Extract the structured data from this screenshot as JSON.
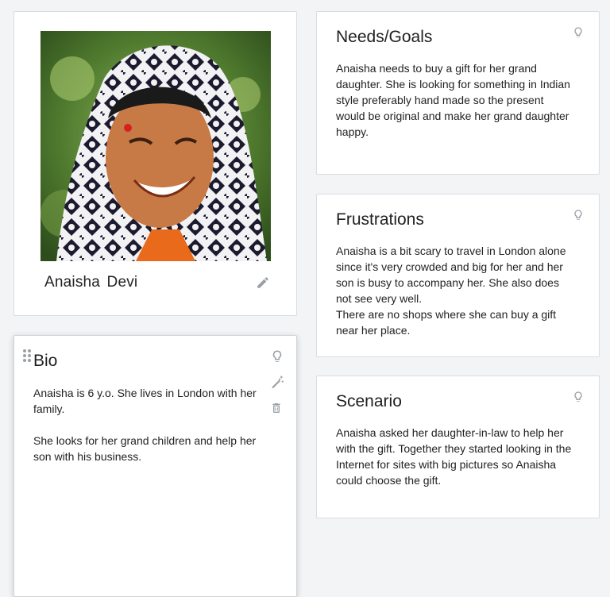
{
  "profile": {
    "name": "Anaisha  Devi",
    "photo_description": "Portrait of smiling woman in patterned headscarf"
  },
  "bio": {
    "title": "Bio",
    "text": "Anaisha is 6 y.o. She lives in London with her family.\n\nShe looks for her grand children and help her son with his business."
  },
  "needs": {
    "title": "Needs/Goals",
    "text": "Anaisha needs to buy a gift for her grand daughter. She is looking for something in Indian style preferably hand made so the present would be original and make her grand daughter happy."
  },
  "frustrations": {
    "title": "Frustrations",
    "text": "Anaisha is a bit scary to travel in London alone since it's very crowded and big for her and her son is busy to accompany her. She also does not see very well.\nThere are no shops where she can buy a gift near her place."
  },
  "scenario": {
    "title": "Scenario",
    "text": "Anaisha asked her daughter-in-law to help her with the gift. Together they started looking in the Internet for sites with big pictures so Anaisha could choose the gift."
  },
  "icons": [
    "pencil-icon",
    "lightbulb-icon",
    "magic-wand-icon",
    "trash-icon",
    "drag-handle-icon"
  ],
  "colors": {
    "icon_gray": "#9aa0a6",
    "border": "#d9dce1",
    "background": "#f3f4f6"
  }
}
